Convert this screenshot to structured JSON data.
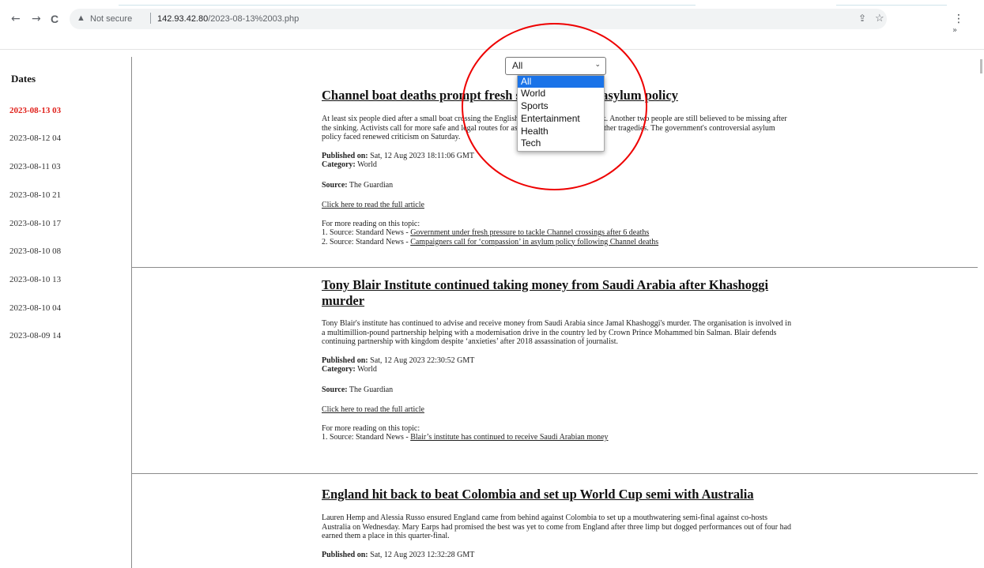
{
  "browser": {
    "back_icon": "←",
    "forward_icon": "→",
    "reload_icon": "C",
    "security_label": "Not secure",
    "url_host": "142.93.42.80",
    "url_path": "/2023-08-13%2003.php",
    "share_icon": "⇪",
    "star_icon": "☆",
    "menu_icon": "⋮",
    "chevron": "»"
  },
  "sidebar": {
    "heading": "Dates",
    "dates": [
      "2023-08-13 03",
      "2023-08-12 04",
      "2023-08-11 03",
      "2023-08-10 21",
      "2023-08-10 17",
      "2023-08-10 08",
      "2023-08-10 13",
      "2023-08-10 04",
      "2023-08-09 14"
    ],
    "active_color": "#e0201a"
  },
  "filter": {
    "selected": "All",
    "options": [
      "All",
      "World",
      "Sports",
      "Entertainment",
      "Health",
      "Tech"
    ],
    "highlight_color": "#1a73e8"
  },
  "labels": {
    "published": "Published on:",
    "category": "Category:",
    "source": "Source:",
    "read_more": "Click here to read the full article",
    "more_reading": "For more reading on this topic:"
  },
  "articles": [
    {
      "title": "Channel boat deaths prompt fresh scrutiny of UK asylum policy",
      "summary": "At least six people died after a small boat crossing the English Channel capsized and sank. Another two people are still believed to be missing after the sinking. Activists call for more safe and legal routes for asylum seekers to prevent further tragedies. The government's controversial asylum policy faced renewed criticism on Saturday.",
      "published": "Sat, 12 Aug 2023 18:11:06 GMT",
      "category": "World",
      "source": "The Guardian",
      "related": [
        {
          "prefix": "1. Source: Standard News - ",
          "link": "Government under fresh pressure to tackle Channel crossings after 6 deaths"
        },
        {
          "prefix": "2. Source: Standard News - ",
          "link": "Campaigners call for ‘compassion’ in asylum policy following Channel deaths"
        }
      ]
    },
    {
      "title": "Tony Blair Institute continued taking money from Saudi Arabia after Khashoggi murder",
      "summary": "Tony Blair's institute has continued to advise and receive money from Saudi Arabia since Jamal Khashoggi's murder. The organisation is involved in a multimillion-pound partnership helping with a modernisation drive in the country led by Crown Prince Mohammed bin Salman. Blair defends continuing partnership with kingdom despite ‘anxieties’ after 2018 assassination of journalist.",
      "published": "Sat, 12 Aug 2023 22:30:52 GMT",
      "category": "World",
      "source": "The Guardian",
      "related": [
        {
          "prefix": "1. Source: Standard News - ",
          "link": "Blair’s institute has continued to receive Saudi Arabian money"
        }
      ]
    },
    {
      "title": "England hit back to beat Colombia and set up World Cup semi with Australia",
      "summary": "Lauren Hemp and Alessia Russo ensured England came from behind against Colombia to set up a mouthwatering semi-final against co-hosts Australia on Wednesday. Mary Earps had promised the best was yet to come from England after three limp but dogged performances out of four had earned them a place in this quarter-final.",
      "published": "Sat, 12 Aug 2023 12:32:28 GMT"
    }
  ]
}
